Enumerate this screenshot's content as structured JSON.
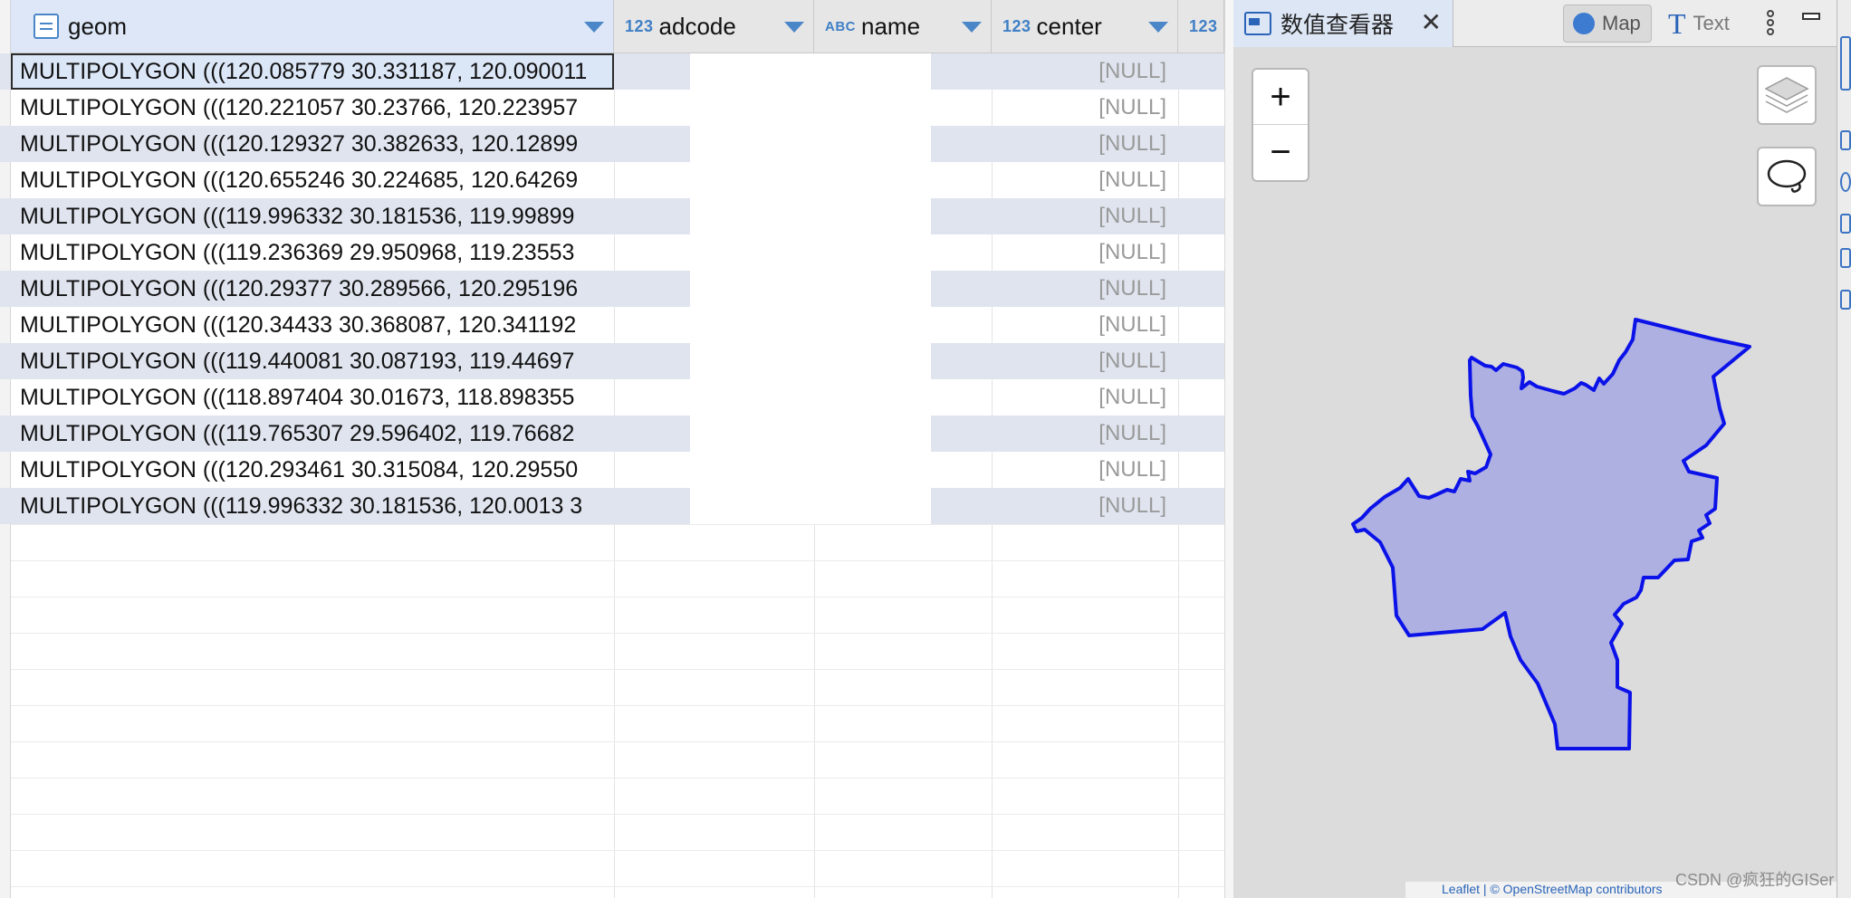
{
  "grid": {
    "columns": [
      {
        "type": "",
        "label": "geom"
      },
      {
        "type": "123",
        "label": "adcode"
      },
      {
        "type": "ABC",
        "label": "name"
      },
      {
        "type": "123",
        "label": "center"
      },
      {
        "type": "123",
        "label": ""
      }
    ],
    "rows": [
      {
        "geom": "MULTIPOLYGON (((120.085779 30.331187, 120.090011",
        "center": "[NULL]"
      },
      {
        "geom": "MULTIPOLYGON (((120.221057 30.23766, 120.223957",
        "center": "[NULL]"
      },
      {
        "geom": "MULTIPOLYGON (((120.129327 30.382633, 120.12899",
        "center": "[NULL]"
      },
      {
        "geom": "MULTIPOLYGON (((120.655246 30.224685, 120.64269",
        "center": "[NULL]"
      },
      {
        "geom": "MULTIPOLYGON (((119.996332 30.181536, 119.99899",
        "center": "[NULL]"
      },
      {
        "geom": "MULTIPOLYGON (((119.236369 29.950968, 119.23553",
        "center": "[NULL]"
      },
      {
        "geom": "MULTIPOLYGON (((120.29377 30.289566, 120.295196",
        "center": "[NULL]"
      },
      {
        "geom": "MULTIPOLYGON (((120.34433 30.368087, 120.341192",
        "center": "[NULL]"
      },
      {
        "geom": "MULTIPOLYGON (((119.440081 30.087193, 119.44697",
        "center": "[NULL]"
      },
      {
        "geom": "MULTIPOLYGON (((118.897404 30.01673, 118.898355",
        "center": "[NULL]"
      },
      {
        "geom": "MULTIPOLYGON (((119.765307 29.596402, 119.76682",
        "center": "[NULL]"
      },
      {
        "geom": "MULTIPOLYGON (((120.293461 30.315084, 120.29550",
        "center": "[NULL]"
      },
      {
        "geom": "MULTIPOLYGON (((119.996332 30.181536, 120.0013 3",
        "center": "[NULL]"
      }
    ]
  },
  "viewer": {
    "tab_title": "数值查看器",
    "close_glyph": "✕",
    "map_button": "Map",
    "text_button": "Text",
    "text_glyph": "T",
    "zoom_in": "+",
    "zoom_out": "−",
    "polygon_fill": "#aeb0e2",
    "polygon_stroke": "#0b12e8",
    "attribution": "Leaflet | © OpenStreetMap contributors"
  },
  "watermark": "CSDN @疯狂的GISer"
}
